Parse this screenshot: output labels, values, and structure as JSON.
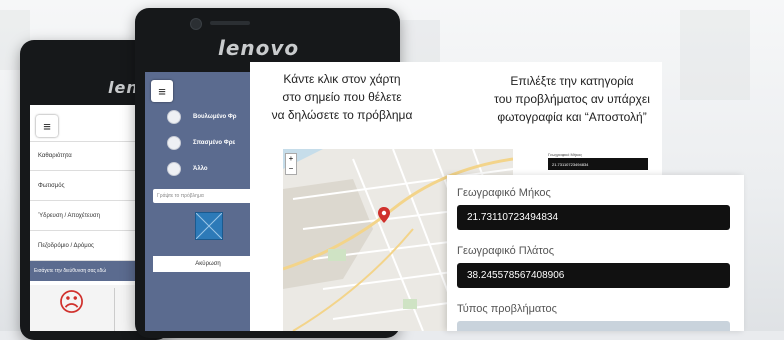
{
  "brand": "lenovo",
  "brand_partial": "len",
  "phone_left": {
    "categories": [
      "Καθαριότητα",
      "Φωτισμός",
      "Ύδρευση / Αποχέτευση",
      "Πεζοδρόμιο / Δρόμος"
    ],
    "footer_hint": "Εισάγετε την διεύθυνση σας εδώ",
    "face_glyph": "☹"
  },
  "phone_right": {
    "options": [
      "Βουλωμένο Φρ",
      "Σπασμένο Φρε",
      "Άλλο"
    ],
    "description_placeholder": "Γράψτε το πρόβλημα",
    "cancel_label": "Ακύρωση"
  },
  "instructions": {
    "map": [
      "Κάντε κλικ στον χάρτη",
      "στο σημείο που θέλετε",
      "να δηλώσετε το πρόβλημα"
    ],
    "category": [
      "Επιλέξτε την κατηγορία",
      "του προβλήματος αν υπάρχει",
      "φωτογραφία και “Αποστολή”"
    ]
  },
  "mini_form": {
    "label": "Γεωγραφικό Μήκος",
    "value": "21.73110723494834"
  },
  "form": {
    "longitude_label": "Γεωγραφικό Μήκος",
    "longitude_value": "21.73110723494834",
    "latitude_label": "Γεωγραφικό Πλάτος",
    "latitude_value": "38.245578567408906",
    "problem_type_label": "Τύπος προβλήματος"
  },
  "map": {
    "zoom_in": "+",
    "zoom_out": "−"
  },
  "colors": {
    "phone_screen_accent": "#5b6b8f",
    "marker": "#d0312d",
    "field_bg": "#111111"
  }
}
